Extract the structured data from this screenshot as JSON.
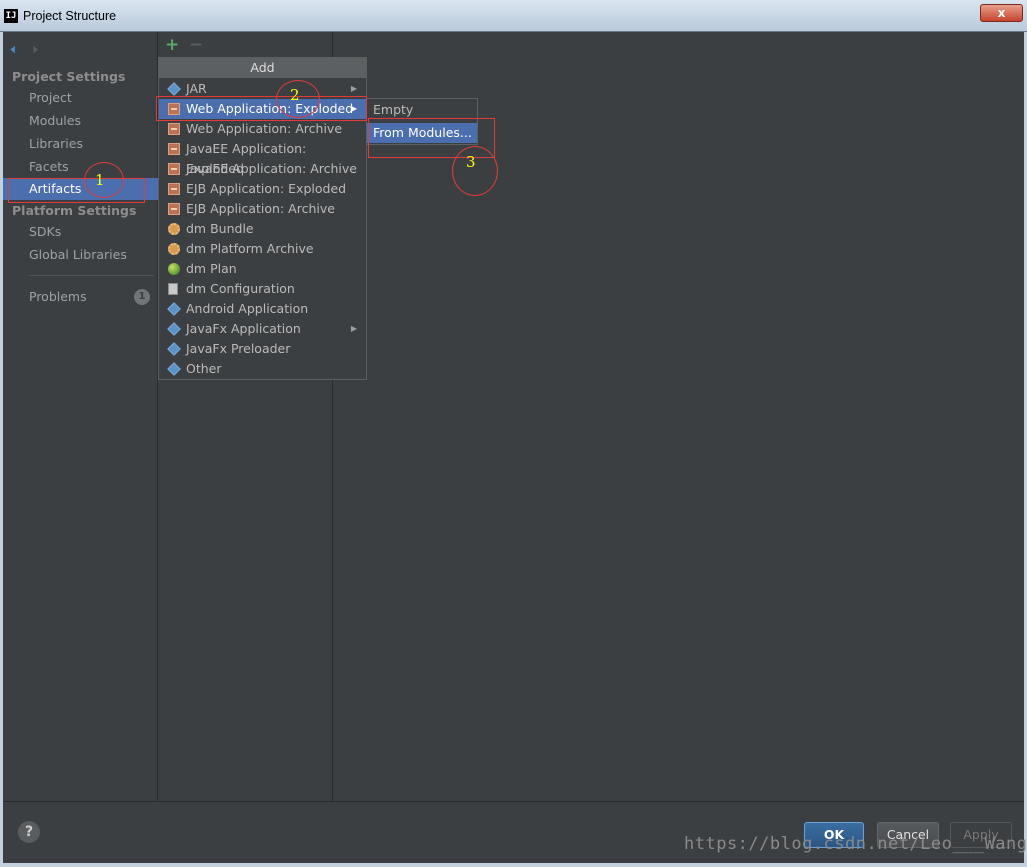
{
  "window": {
    "title": "Project Structure",
    "app_icon": "IJ",
    "close_label": "x"
  },
  "nav": {
    "back_icon": "back-arrow-icon",
    "forward_icon": "forward-arrow-icon"
  },
  "sidebar": {
    "project_settings_title": "Project Settings",
    "project_items": [
      "Project",
      "Modules",
      "Libraries",
      "Facets",
      "Artifacts"
    ],
    "selected": "Artifacts",
    "platform_settings_title": "Platform Settings",
    "platform_items": [
      "SDKs",
      "Global Libraries"
    ],
    "problems_label": "Problems",
    "problems_count": "1"
  },
  "toolbar": {
    "add_icon": "+",
    "remove_icon": "−"
  },
  "popup": {
    "title": "Add",
    "items": [
      {
        "label": "JAR",
        "icon": "diamond-icon",
        "submenu": true
      },
      {
        "label": "Web Application: Exploded",
        "icon": "package-icon",
        "submenu": true,
        "selected": true
      },
      {
        "label": "Web Application: Archive",
        "icon": "package-icon"
      },
      {
        "label": "JavaEE Application: Exploded",
        "icon": "package-icon"
      },
      {
        "label": "JavaEE Application: Archive",
        "icon": "package-icon"
      },
      {
        "label": "EJB Application: Exploded",
        "icon": "package-icon"
      },
      {
        "label": "EJB Application: Archive",
        "icon": "package-icon"
      },
      {
        "label": "dm Bundle",
        "icon": "gear-icon"
      },
      {
        "label": "dm Platform Archive",
        "icon": "gear-icon"
      },
      {
        "label": "dm Plan",
        "icon": "globe-icon"
      },
      {
        "label": "dm Configuration",
        "icon": "document-icon"
      },
      {
        "label": "Android Application",
        "icon": "diamond-icon"
      },
      {
        "label": "JavaFx Application",
        "icon": "diamond-icon",
        "submenu": true
      },
      {
        "label": "JavaFx Preloader",
        "icon": "diamond-icon"
      },
      {
        "label": "Other",
        "icon": "diamond-icon"
      }
    ]
  },
  "submenu": {
    "items": [
      "Empty",
      "From Modules..."
    ],
    "selected": "From Modules..."
  },
  "annotations": {
    "labels": [
      "1",
      "2",
      "3"
    ],
    "color": "#e23b3b",
    "number_color": "#ffff00"
  },
  "buttons": {
    "help": "?",
    "ok": "OK",
    "cancel": "Cancel",
    "apply": "Apply"
  },
  "watermark": "https://blog.csdn.net/Leo___Wang",
  "colors": {
    "selection": "#4b6eaf",
    "panel": "#3c3f41",
    "accent_add": "#59a869"
  }
}
